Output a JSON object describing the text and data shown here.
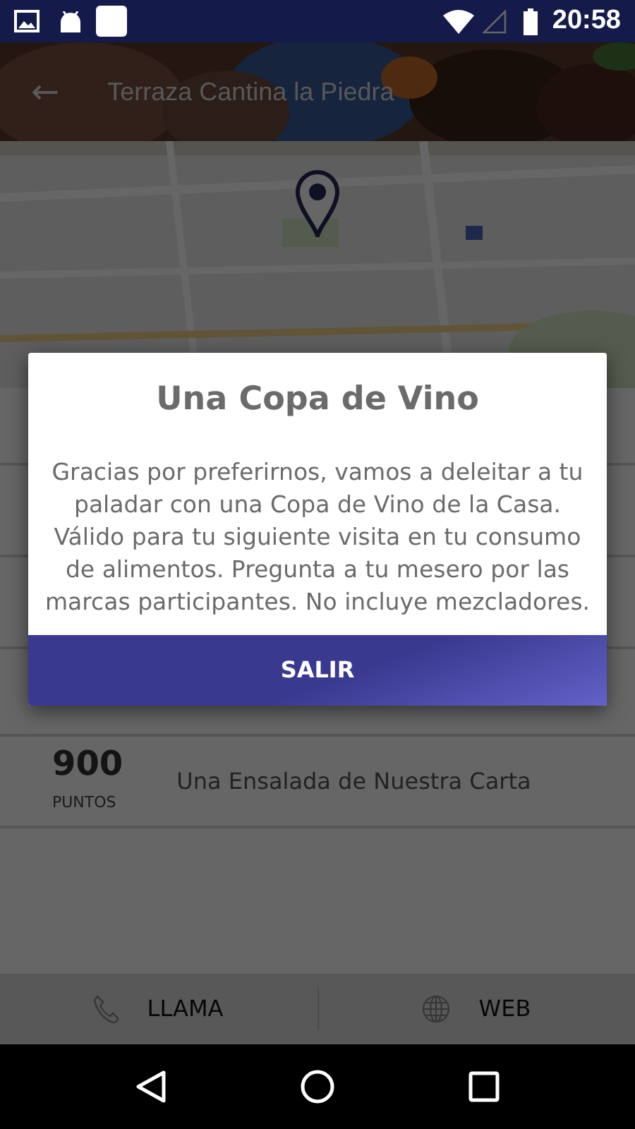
{
  "status_bar": {
    "time": "20:58"
  },
  "header": {
    "title": "Terraza Cantina la Piedra",
    "back_icon": "←"
  },
  "rewards": [
    {
      "points": "900",
      "unit": "PUNTOS",
      "description": "Una Ensalada de Nuestra Carta"
    }
  ],
  "actions": [
    {
      "kind": "phone",
      "label": "LLAMA"
    },
    {
      "kind": "web",
      "label": "WEB"
    }
  ],
  "dialog": {
    "title": "Una Copa de Vino",
    "message": "Gracias por preferirnos, vamos a deleitar a tu paladar con una Copa de Vino de la Casa. Válido para tu siguiente visita en tu consumo de alimentos. Pregunta a tu mesero por las marcas participantes. No incluye mezcladores.",
    "button": "SALIR"
  }
}
